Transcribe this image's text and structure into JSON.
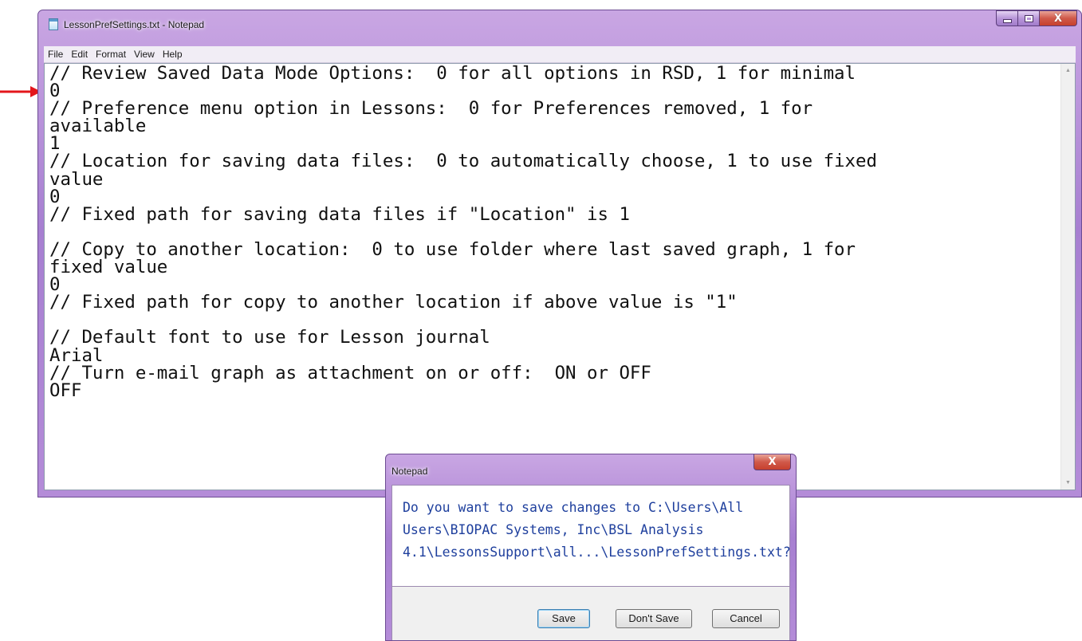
{
  "window": {
    "title": "LessonPrefSettings.txt - Notepad",
    "icon": "notepad-icon",
    "caption_buttons": [
      "minimize",
      "maximize",
      "close"
    ],
    "close_glyph": "X"
  },
  "menu": {
    "items": [
      {
        "label": "File"
      },
      {
        "label": "Edit"
      },
      {
        "label": "Format"
      },
      {
        "label": "View"
      },
      {
        "label": "Help"
      }
    ]
  },
  "editor": {
    "content": "// Review Saved Data Mode Options:  0 for all options in RSD, 1 for minimal\n0\n// Preference menu option in Lessons:  0 for Preferences removed, 1 for\navailable\n1\n// Location for saving data files:  0 to automatically choose, 1 to use fixed\nvalue\n0\n// Fixed path for saving data files if \"Location\" is 1\n\n// Copy to another location:  0 to use folder where last saved graph, 1 for\nfixed value\n0\n// Fixed path for copy to another location if above value is \"1\"\n\n// Default font to use for Lesson journal\nArial\n// Turn e-mail graph as attachment on or off:  ON or OFF\nOFF",
    "scroll_up_glyph": "▲",
    "scroll_down_glyph": "▼"
  },
  "marker": {
    "color": "#e3161b",
    "icon": "red-arrow-icon"
  },
  "dialog": {
    "title": "Notepad",
    "close_glyph": "X",
    "message": "Do you want to save changes to C:\\Users\\All\nUsers\\BIOPAC Systems, Inc\\BSL Analysis\n4.1\\LessonsSupport\\all...\\LessonPrefSettings.txt?",
    "message_color": "#1e3f9d",
    "buttons": {
      "save": "Save",
      "dont_save": "Don't Save",
      "cancel": "Cancel"
    }
  },
  "colors": {
    "titlebar": "#b48cd8",
    "close_button": "#c7402d"
  }
}
